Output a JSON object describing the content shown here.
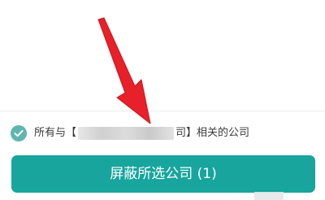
{
  "consent": {
    "checked": true,
    "prefix": "所有与【",
    "company_masked": "",
    "suffix": "司】相关的公司"
  },
  "primary_button": {
    "label": "屏蔽所选公司 (1)"
  },
  "icons": {
    "checkbox": "check-circle-icon",
    "annotation": "red-arrow-icon"
  },
  "colors": {
    "accent": "#17a59e",
    "checkbox": "#5fb6b0",
    "arrow": "#e8202a",
    "text": "#3a3a3a"
  }
}
